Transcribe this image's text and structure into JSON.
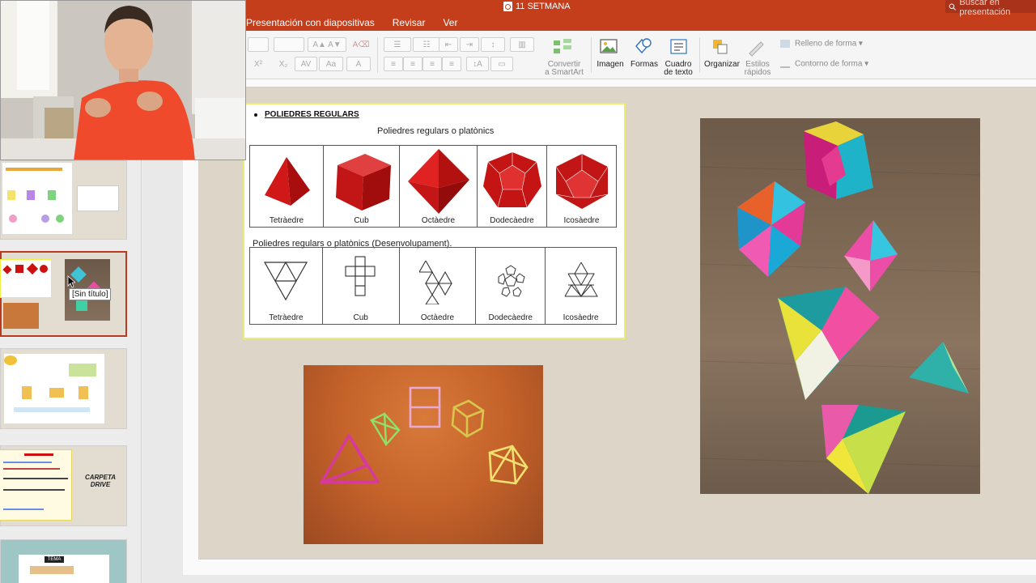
{
  "window": {
    "title": "11 SETMANA",
    "search_placeholder": "Buscar en presentación"
  },
  "menu": [
    "Presentación con diapositivas",
    "Revisar",
    "Ver"
  ],
  "ribbon": {
    "convert_smartart": [
      "Convertir",
      "a SmartArt"
    ],
    "image": "Imagen",
    "shapes": "Formas",
    "textbox": [
      "Cuadro",
      "de texto"
    ],
    "arrange": "Organizar",
    "quick_styles": [
      "Estilos",
      "rápidos"
    ],
    "shape_fill": "Relleno de forma",
    "shape_outline": "Contorno de forma"
  },
  "thumbnails": {
    "tooltip": "[Sin título]",
    "drive_label": [
      "CARPETA",
      "DRIVE"
    ],
    "section_tag": "TEMA 10"
  },
  "worksheet": {
    "heading": "POLIEDRES REGULARS",
    "subtitle_solids": "Poliedres regulars o platònics",
    "subtitle_nets": "Poliedres regulars o platònics (Desenvolupament).",
    "solids": [
      "Tetràedre",
      "Cub",
      "Octàedre",
      "Dodecàedre",
      "Icosàedre"
    ],
    "nets": [
      "Tetràedre",
      "Cub",
      "Octàedre",
      "Dodecàedre",
      "Icosàedre"
    ]
  },
  "colors": {
    "titlebar": "#c43e1c",
    "selected_thumb": "#b73a21",
    "solid_red": "#cc1111",
    "straw_pink": "#d63a9c"
  }
}
